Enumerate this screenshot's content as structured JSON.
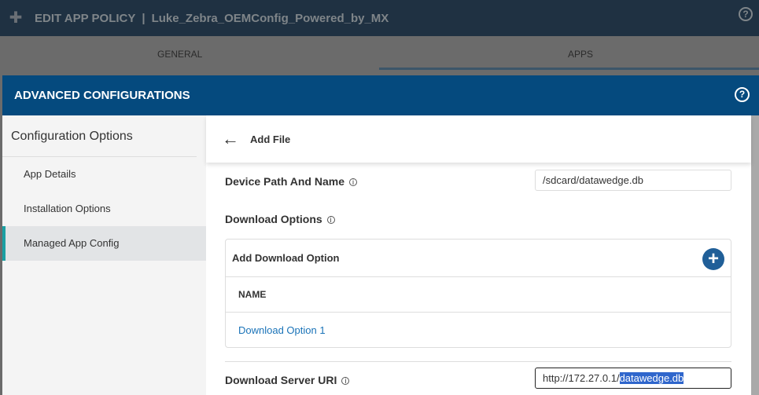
{
  "header": {
    "title": "EDIT APP POLICY",
    "separator": "|",
    "policy_name": "Luke_Zebra_OEMConfig_Powered_by_MX",
    "help": "?"
  },
  "tabs": [
    {
      "label": "GENERAL"
    },
    {
      "label": "APPS"
    }
  ],
  "modal": {
    "title": "ADVANCED CONFIGURATIONS",
    "help": "?",
    "sidebar": {
      "heading": "Configuration Options",
      "items": [
        {
          "label": "App Details"
        },
        {
          "label": "Installation Options"
        },
        {
          "label": "Managed App Config"
        }
      ]
    },
    "content": {
      "back": "←",
      "title": "Add File",
      "device_path_label": "Device Path And Name",
      "device_path_value": "/sdcard/datawedge.db",
      "download_options_label": "Download Options",
      "add_download_option": "Add Download Option",
      "plus": "+",
      "column_name": "NAME",
      "option_link": "Download Option 1",
      "server_uri_label": "Download Server URI",
      "server_uri_prefix": "http://172.27.0.1/",
      "server_uri_selected": "datawedge.db",
      "info": "i"
    }
  }
}
